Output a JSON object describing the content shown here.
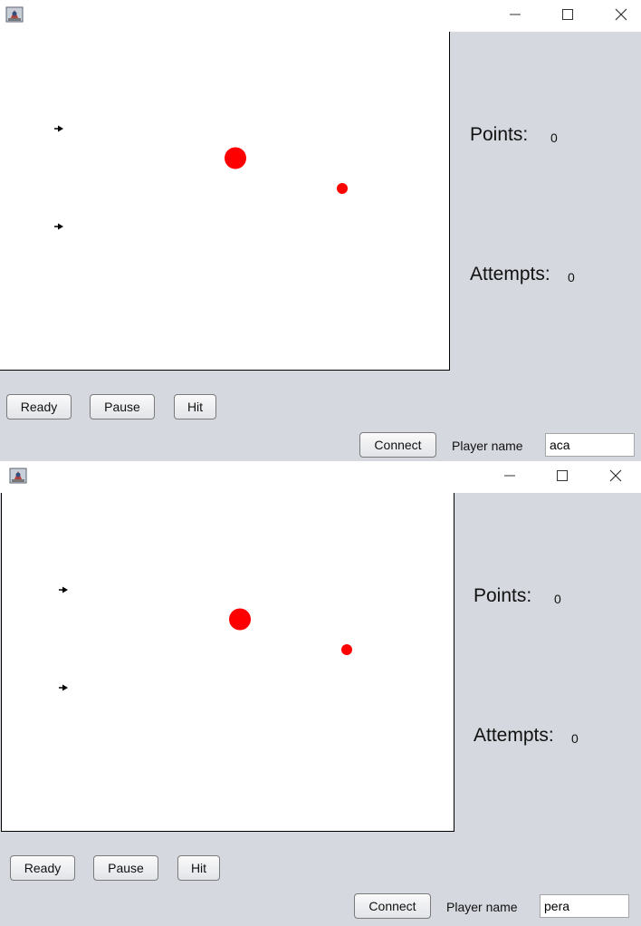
{
  "windows": [
    {
      "title": "",
      "points_label": "Points:",
      "points_value": "0",
      "attempts_label": "Attempts:",
      "attempts_value": "0",
      "buttons": {
        "ready": "Ready",
        "pause": "Pause",
        "hit": "Hit",
        "connect": "Connect"
      },
      "player_name_label": "Player name",
      "player_name_value": "aca"
    },
    {
      "title": "",
      "points_label": "Points:",
      "points_value": "0",
      "attempts_label": "Attempts:",
      "attempts_value": "0",
      "buttons": {
        "ready": "Ready",
        "pause": "Pause",
        "hit": "Hit",
        "connect": "Connect"
      },
      "player_name_label": "Player name",
      "player_name_value": "pera"
    }
  ],
  "colors": {
    "target": "#ff0000",
    "arrow": "#000000",
    "panel_bg": "#d5d8de"
  },
  "icons": [
    "java-app-icon",
    "minimize-icon",
    "maximize-icon",
    "close-icon",
    "arrow-icon",
    "target-ball"
  ]
}
